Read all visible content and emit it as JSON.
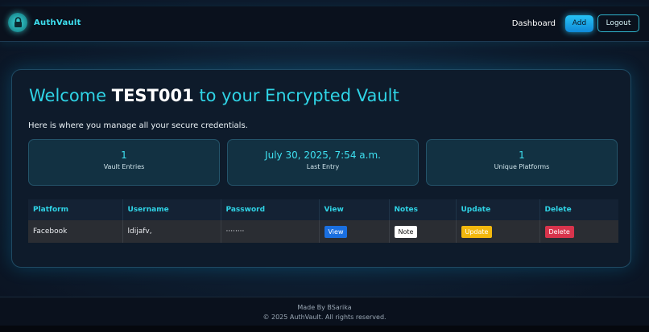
{
  "navbar": {
    "brand_name": "AuthVault",
    "logo_icon": "lock-icon",
    "links": {
      "dashboard": "Dashboard",
      "add": "Add",
      "logout": "Logout"
    }
  },
  "welcome": {
    "prefix": "Welcome",
    "username": "TEST001",
    "suffix": "to your Encrypted Vault",
    "subtitle": "Here is where you manage all your secure credentials."
  },
  "stats": [
    {
      "value": "1",
      "label": "Vault Entries"
    },
    {
      "value": "July 30, 2025, 7:54 a.m.",
      "label": "Last Entry"
    },
    {
      "value": "1",
      "label": "Unique Platforms"
    }
  ],
  "table": {
    "headers": [
      "Platform",
      "Username",
      "Password",
      "View",
      "Notes",
      "Update",
      "Delete"
    ],
    "rows": [
      {
        "platform": "Facebook",
        "username": "ldijafv,",
        "password": "········",
        "view_label": "View",
        "notes_label": "Note",
        "update_label": "Update",
        "delete_label": "Delete"
      }
    ]
  },
  "footer": {
    "made_by": "Made By BSarika",
    "copyright": "© 2025 AuthVault. All rights reserved."
  },
  "colors": {
    "accent": "#2fd4e6",
    "view_button": "#1a6fe0",
    "update_button": "#f3b80e",
    "delete_button": "#d8344c"
  }
}
